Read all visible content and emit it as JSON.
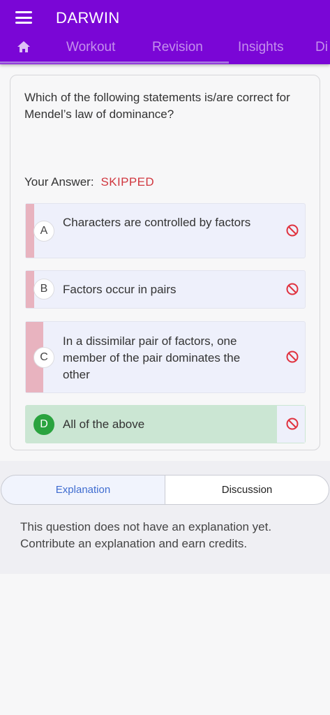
{
  "app": {
    "title": "DARWIN",
    "accent_color": "#7a06d6"
  },
  "tabs": [
    {
      "label": "Workout"
    },
    {
      "label": "Revision"
    },
    {
      "label": "Insights"
    },
    {
      "label": "Di"
    }
  ],
  "question": {
    "text": "Which of the following statements is/are correct for Mendel’s law of dominance?",
    "your_answer_label": "Your Answer:",
    "your_answer_value": "SKIPPED"
  },
  "options": [
    {
      "letter": "A",
      "text": "Characters are controlled by factors",
      "status": "blocked-icon"
    },
    {
      "letter": "B",
      "text": "Factors occur in pairs",
      "status": "blocked-icon"
    },
    {
      "letter": "C",
      "text": "In a dissimilar pair of factors, one member of the pair dominates the other",
      "status": "blocked-icon"
    },
    {
      "letter": "D",
      "text": "All of the above",
      "status": "blocked-icon",
      "correct": true
    }
  ],
  "panel": {
    "explanation_tab": "Explanation",
    "discussion_tab": "Discussion",
    "explanation_text": "This question does not have an explanation yet. Contribute an explanation and earn credits."
  }
}
